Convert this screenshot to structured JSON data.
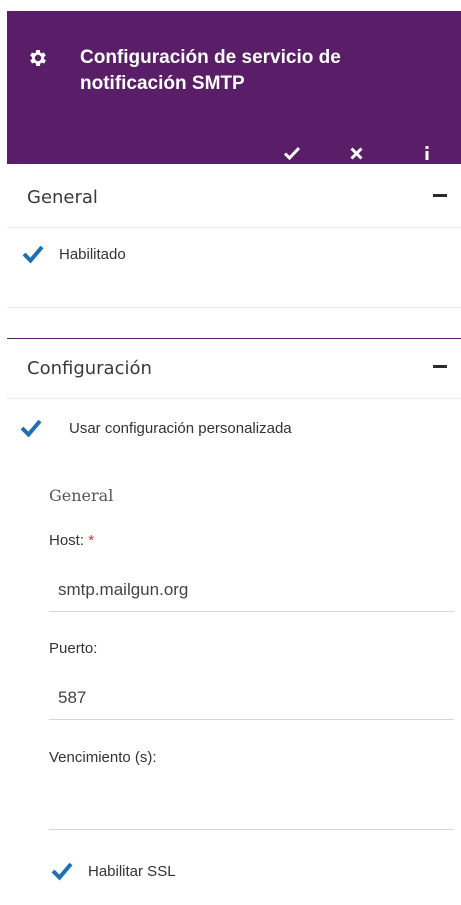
{
  "header": {
    "title": "Configuración de servicio de notificación SMTP",
    "accent": "#5a1e68",
    "icons": [
      "gear-icon",
      "check-icon",
      "close-icon",
      "info-icon"
    ]
  },
  "general_panel": {
    "title": "General",
    "enabled_label": "Habilitado",
    "enabled": true
  },
  "config_panel": {
    "title": "Configuración",
    "custom_label": "Usar configuración personalizada",
    "custom": true,
    "section_title": "General",
    "host_label": "Host:",
    "host_required": "*",
    "host_value": "smtp.mailgun.org",
    "port_label": "Puerto:",
    "port_value": "587",
    "timeout_label": "Vencimiento (s):",
    "timeout_value": "",
    "ssl_label": "Habilitar SSL",
    "ssl": true
  },
  "colors": {
    "checkbox": "#1e6fb5",
    "header_bg": "#5a1e68"
  }
}
